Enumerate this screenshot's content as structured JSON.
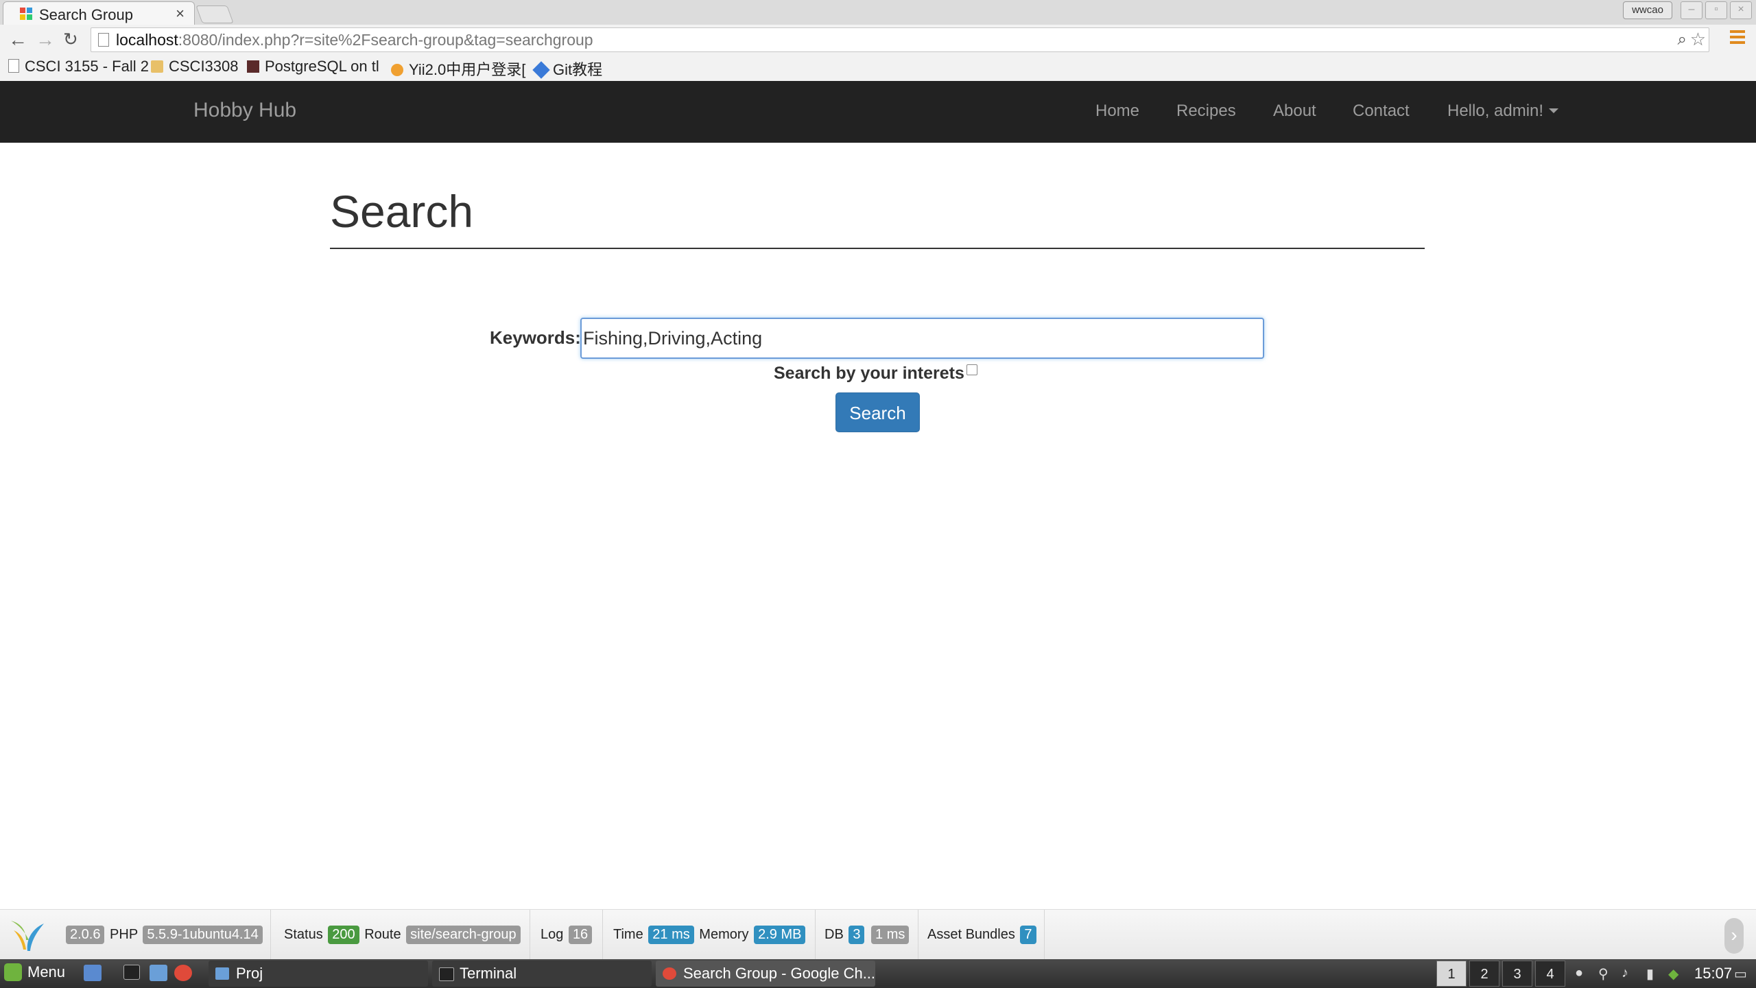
{
  "browser": {
    "tab_title": "Search Group",
    "tab_close": "×",
    "url_host": "localhost",
    "url_rest": ":8080/index.php?r=site%2Fsearch-group&tag=searchgroup",
    "profile_name": "wwcao",
    "bookmarks": [
      "CSCI 3155 - Fall 2",
      "CSCI3308",
      "PostgreSQL on tl",
      "Yii2.0中用户登录[",
      "Git教程"
    ]
  },
  "navbar": {
    "brand": "Hobby Hub",
    "links": [
      "Home",
      "Recipes",
      "About",
      "Contact"
    ],
    "user_menu": "Hello, admin!"
  },
  "main": {
    "title": "Search",
    "keywords_label": "Keywords:",
    "keywords_value": "Fishing,Driving,Acting",
    "interests_label": "Search by your interets",
    "interests_checked": false,
    "search_button": "Search"
  },
  "debug": {
    "yii_version": "2.0.6",
    "php_label": "PHP",
    "php_version": "5.5.9-1ubuntu4.14",
    "status_label": "Status",
    "status_value": "200",
    "route_label": "Route",
    "route_value": "site/search-group",
    "log_label": "Log",
    "log_value": "16",
    "time_label": "Time",
    "time_value": "21 ms",
    "memory_label": "Memory",
    "memory_value": "2.9 MB",
    "db_label": "DB",
    "db_count": "3",
    "db_time": "1 ms",
    "assets_label": "Asset Bundles",
    "assets_value": "7"
  },
  "taskbar": {
    "menu_label": "Menu",
    "windows": [
      "Proj",
      "Terminal",
      "Search Group - Google Ch..."
    ],
    "workspaces": [
      "1",
      "2",
      "3",
      "4"
    ],
    "active_workspace": "1",
    "clock": "15:07"
  },
  "colors": {
    "navbar_bg": "#222222",
    "primary_button": "#337ab7",
    "status_ok": "#4a9a40",
    "debug_label_blue": "#3090c0"
  }
}
